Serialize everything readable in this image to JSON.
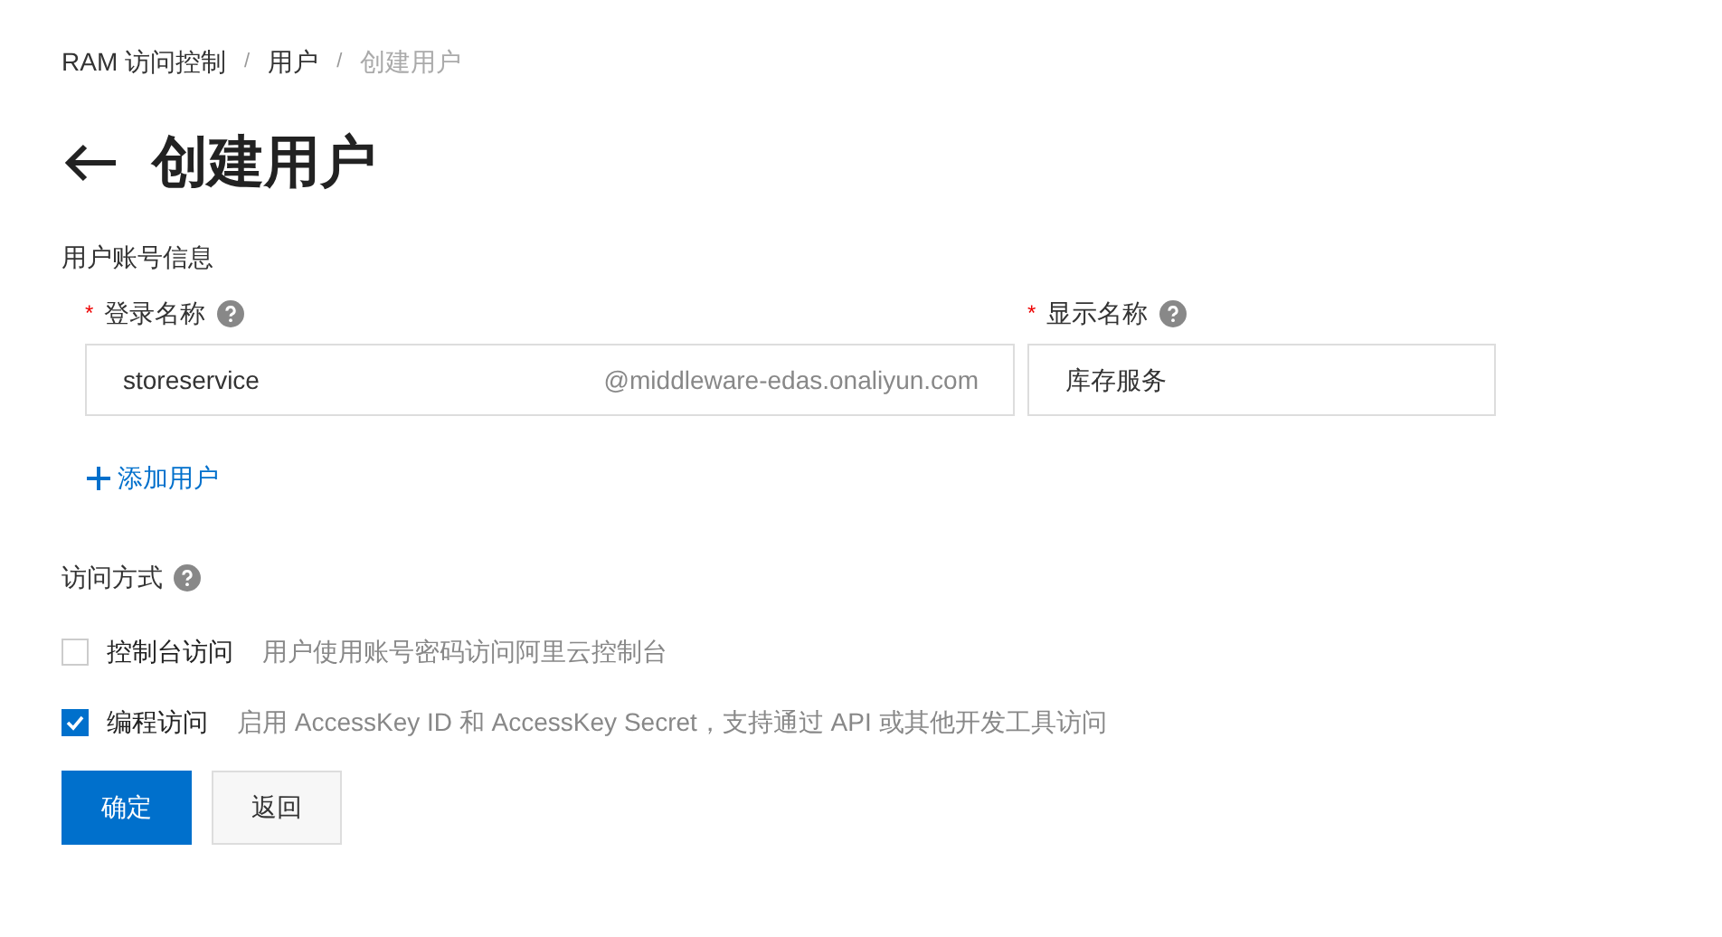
{
  "breadcrumb": [
    {
      "label": "RAM 访问控制",
      "current": false
    },
    {
      "label": "用户",
      "current": false
    },
    {
      "label": "创建用户",
      "current": true
    }
  ],
  "separator": "/",
  "title": "创建用户",
  "section_label": "用户账号信息",
  "fields": [
    {
      "label": "登录名称",
      "required": true,
      "value": "storeservice",
      "suffix": "@middleware-edas.onaliyun.com"
    },
    {
      "label": "显示名称",
      "required": true,
      "value": "库存服务"
    }
  ],
  "required_mark": "*",
  "add_user": "添加用户",
  "access": {
    "label": "访问方式",
    "options": [
      {
        "label": "控制台访问",
        "description": "用户使用账号密码访问阿里云控制台",
        "checked": false
      },
      {
        "label": "编程访问",
        "description": "启用 AccessKey ID 和 AccessKey Secret，支持通过 API 或其他开发工具访问",
        "checked": true
      }
    ]
  },
  "buttons": [
    {
      "label": "确定",
      "kind": "primary"
    },
    {
      "label": "返回",
      "kind": "secondary"
    }
  ]
}
